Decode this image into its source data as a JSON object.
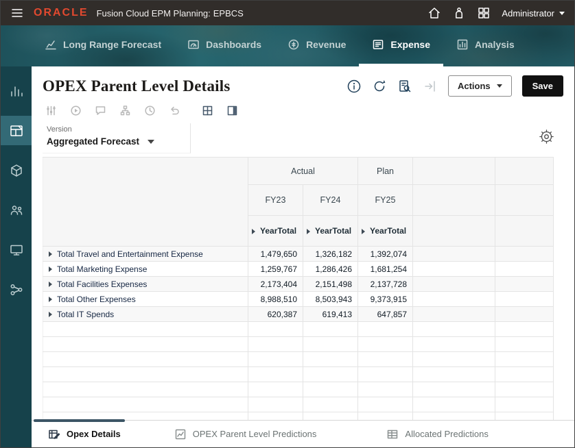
{
  "topbar": {
    "brand": "ORACLE",
    "app_title": "Fusion Cloud EPM Planning:",
    "app_code": "EPBCS",
    "user_menu": "Administrator"
  },
  "nav_tabs": [
    {
      "label": "Long Range Forecast"
    },
    {
      "label": "Dashboards"
    },
    {
      "label": "Revenue"
    },
    {
      "label": "Expense"
    },
    {
      "label": "Analysis"
    }
  ],
  "page": {
    "title": "OPEX Parent Level Details",
    "actions_button": "Actions",
    "save_button": "Save"
  },
  "pov": {
    "dimension": "Version",
    "selected_member": "Aggregated Forecast"
  },
  "grid": {
    "scenario_row": {
      "actual": "Actual",
      "plan": "Plan"
    },
    "years": {
      "col1": "FY23",
      "col2": "FY24",
      "col3": "FY25"
    },
    "periods": {
      "col1": "YearTotal",
      "col2": "YearTotal",
      "col3": "YearTotal"
    },
    "rows": [
      {
        "label": "Total Travel and Entertainment Expense",
        "fy23": "1,479,650",
        "fy24": "1,326,182",
        "fy25": "1,392,074"
      },
      {
        "label": "Total Marketing Expense",
        "fy23": "1,259,767",
        "fy24": "1,286,426",
        "fy25": "1,681,254"
      },
      {
        "label": "Total Facilities Expenses",
        "fy23": "2,173,404",
        "fy24": "2,151,498",
        "fy25": "2,137,728"
      },
      {
        "label": "Total Other Expenses",
        "fy23": "8,988,510",
        "fy24": "8,503,943",
        "fy25": "9,373,915"
      },
      {
        "label": "Total IT Spends",
        "fy23": "620,387",
        "fy24": "619,413",
        "fy25": "647,857"
      }
    ]
  },
  "bottom_tabs": [
    {
      "label": "Opex Details"
    },
    {
      "label": "OPEX Parent Level Predictions"
    },
    {
      "label": "Allocated Predictions"
    }
  ],
  "icons": [
    "hamburger-menu-icon",
    "home-icon",
    "assistance-icon",
    "apps-grid-icon",
    "caret-down-icon",
    "forecast-icon",
    "dashboards-icon",
    "revenue-icon",
    "expense-icon",
    "analysis-icon",
    "analytics-icon",
    "forms-icon",
    "cube-icon",
    "users-icon",
    "approvals-icon",
    "process-icon",
    "info-icon",
    "refresh-icon",
    "grid-search-icon",
    "open-drawer-icon",
    "adjust-icon",
    "rules-icon",
    "comment-icon",
    "hierarchy-icon",
    "history-icon",
    "undo-icon",
    "grid-icon",
    "format-icon",
    "gear-icon",
    "expand-icon",
    "opex-details-icon",
    "predictions-icon",
    "allocated-icon"
  ],
  "colors": {
    "topbar_bg": "#312d2a",
    "oracle_red": "#e2492f",
    "banner_teal": "#215b64",
    "rail_teal": "#16424b",
    "rail_active": "#336a76",
    "active_tab_underline": "#ffffff",
    "save_button_bg": "#111111",
    "footer_indicator": "#3c5565",
    "grid_border": "#e4e4e4",
    "header_bg": "#f6f6f6",
    "row_label_color": "#152642"
  }
}
